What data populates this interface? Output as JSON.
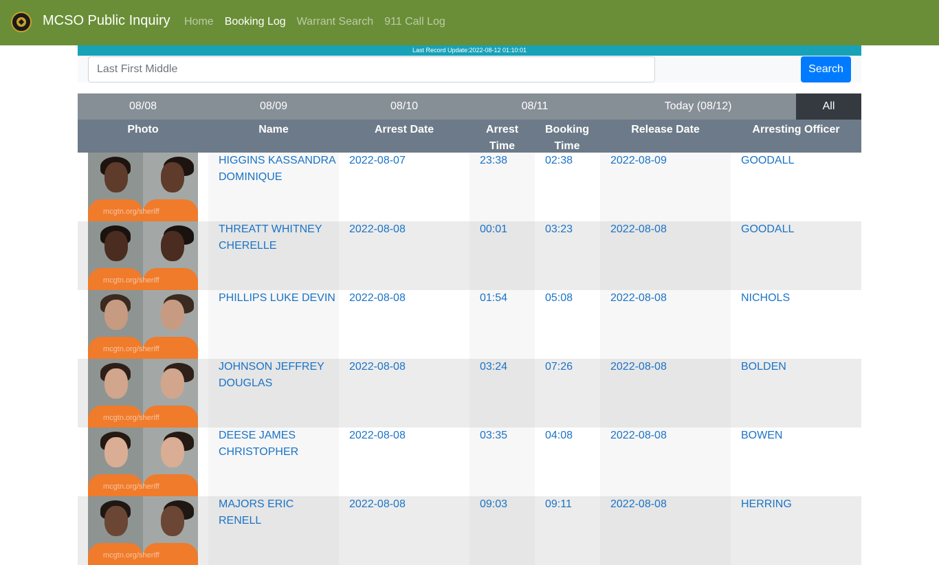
{
  "navbar": {
    "brand": "MCSO Public Inquiry",
    "links": [
      {
        "label": "Home",
        "active": false
      },
      {
        "label": "Booking Log",
        "active": true
      },
      {
        "label": "Warrant Search",
        "active": false
      },
      {
        "label": "911 Call Log",
        "active": false
      }
    ]
  },
  "update_bar": "Last Record Update:2022-08-12 01:10:01",
  "search": {
    "placeholder": "Last First Middle",
    "value": "",
    "button": "Search"
  },
  "tabs": [
    {
      "label": "08/08",
      "active": false
    },
    {
      "label": "08/09",
      "active": false
    },
    {
      "label": "08/10",
      "active": false
    },
    {
      "label": "08/11",
      "active": false
    },
    {
      "label": "Today (08/12)",
      "active": false
    },
    {
      "label": "All",
      "active": true
    }
  ],
  "table": {
    "headers": {
      "photo": "Photo",
      "name": "Name",
      "arrest_date": "Arrest Date",
      "arrest_time": "Arrest Time",
      "booking_time": "Booking Time",
      "release_date": "Release Date",
      "officer": "Arresting Officer"
    },
    "watermark": "mcgtn.org/sheriff",
    "rows": [
      {
        "name": "HIGGINS KASSANDRA DOMINIQUE",
        "arrest_date": "2022-08-07",
        "arrest_time": "23:38",
        "booking_time": "02:38",
        "release_date": "2022-08-09",
        "officer": "GOODALL"
      },
      {
        "name": "THREATT WHITNEY CHERELLE",
        "arrest_date": "2022-08-08",
        "arrest_time": "00:01",
        "booking_time": "03:23",
        "release_date": "2022-08-08",
        "officer": "GOODALL"
      },
      {
        "name": "PHILLIPS LUKE DEVIN",
        "arrest_date": "2022-08-08",
        "arrest_time": "01:54",
        "booking_time": "05:08",
        "release_date": "2022-08-08",
        "officer": "NICHOLS"
      },
      {
        "name": "JOHNSON JEFFREY DOUGLAS",
        "arrest_date": "2022-08-08",
        "arrest_time": "03:24",
        "booking_time": "07:26",
        "release_date": "2022-08-08",
        "officer": "BOLDEN"
      },
      {
        "name": "DEESE JAMES CHRISTOPHER",
        "arrest_date": "2022-08-08",
        "arrest_time": "03:35",
        "booking_time": "04:08",
        "release_date": "2022-08-08",
        "officer": "BOWEN"
      },
      {
        "name": "MAJORS ERIC RENELL",
        "arrest_date": "2022-08-08",
        "arrest_time": "09:03",
        "booking_time": "09:11",
        "release_date": "2022-08-08",
        "officer": "HERRING"
      }
    ]
  },
  "colors": {
    "navbar": "#6a8e37",
    "update_bar": "#17a2b8",
    "tabs": "#868e96",
    "tab_active": "#343a40",
    "header": "#6c7a89",
    "link": "#1a73c6",
    "button": "#007bff"
  }
}
